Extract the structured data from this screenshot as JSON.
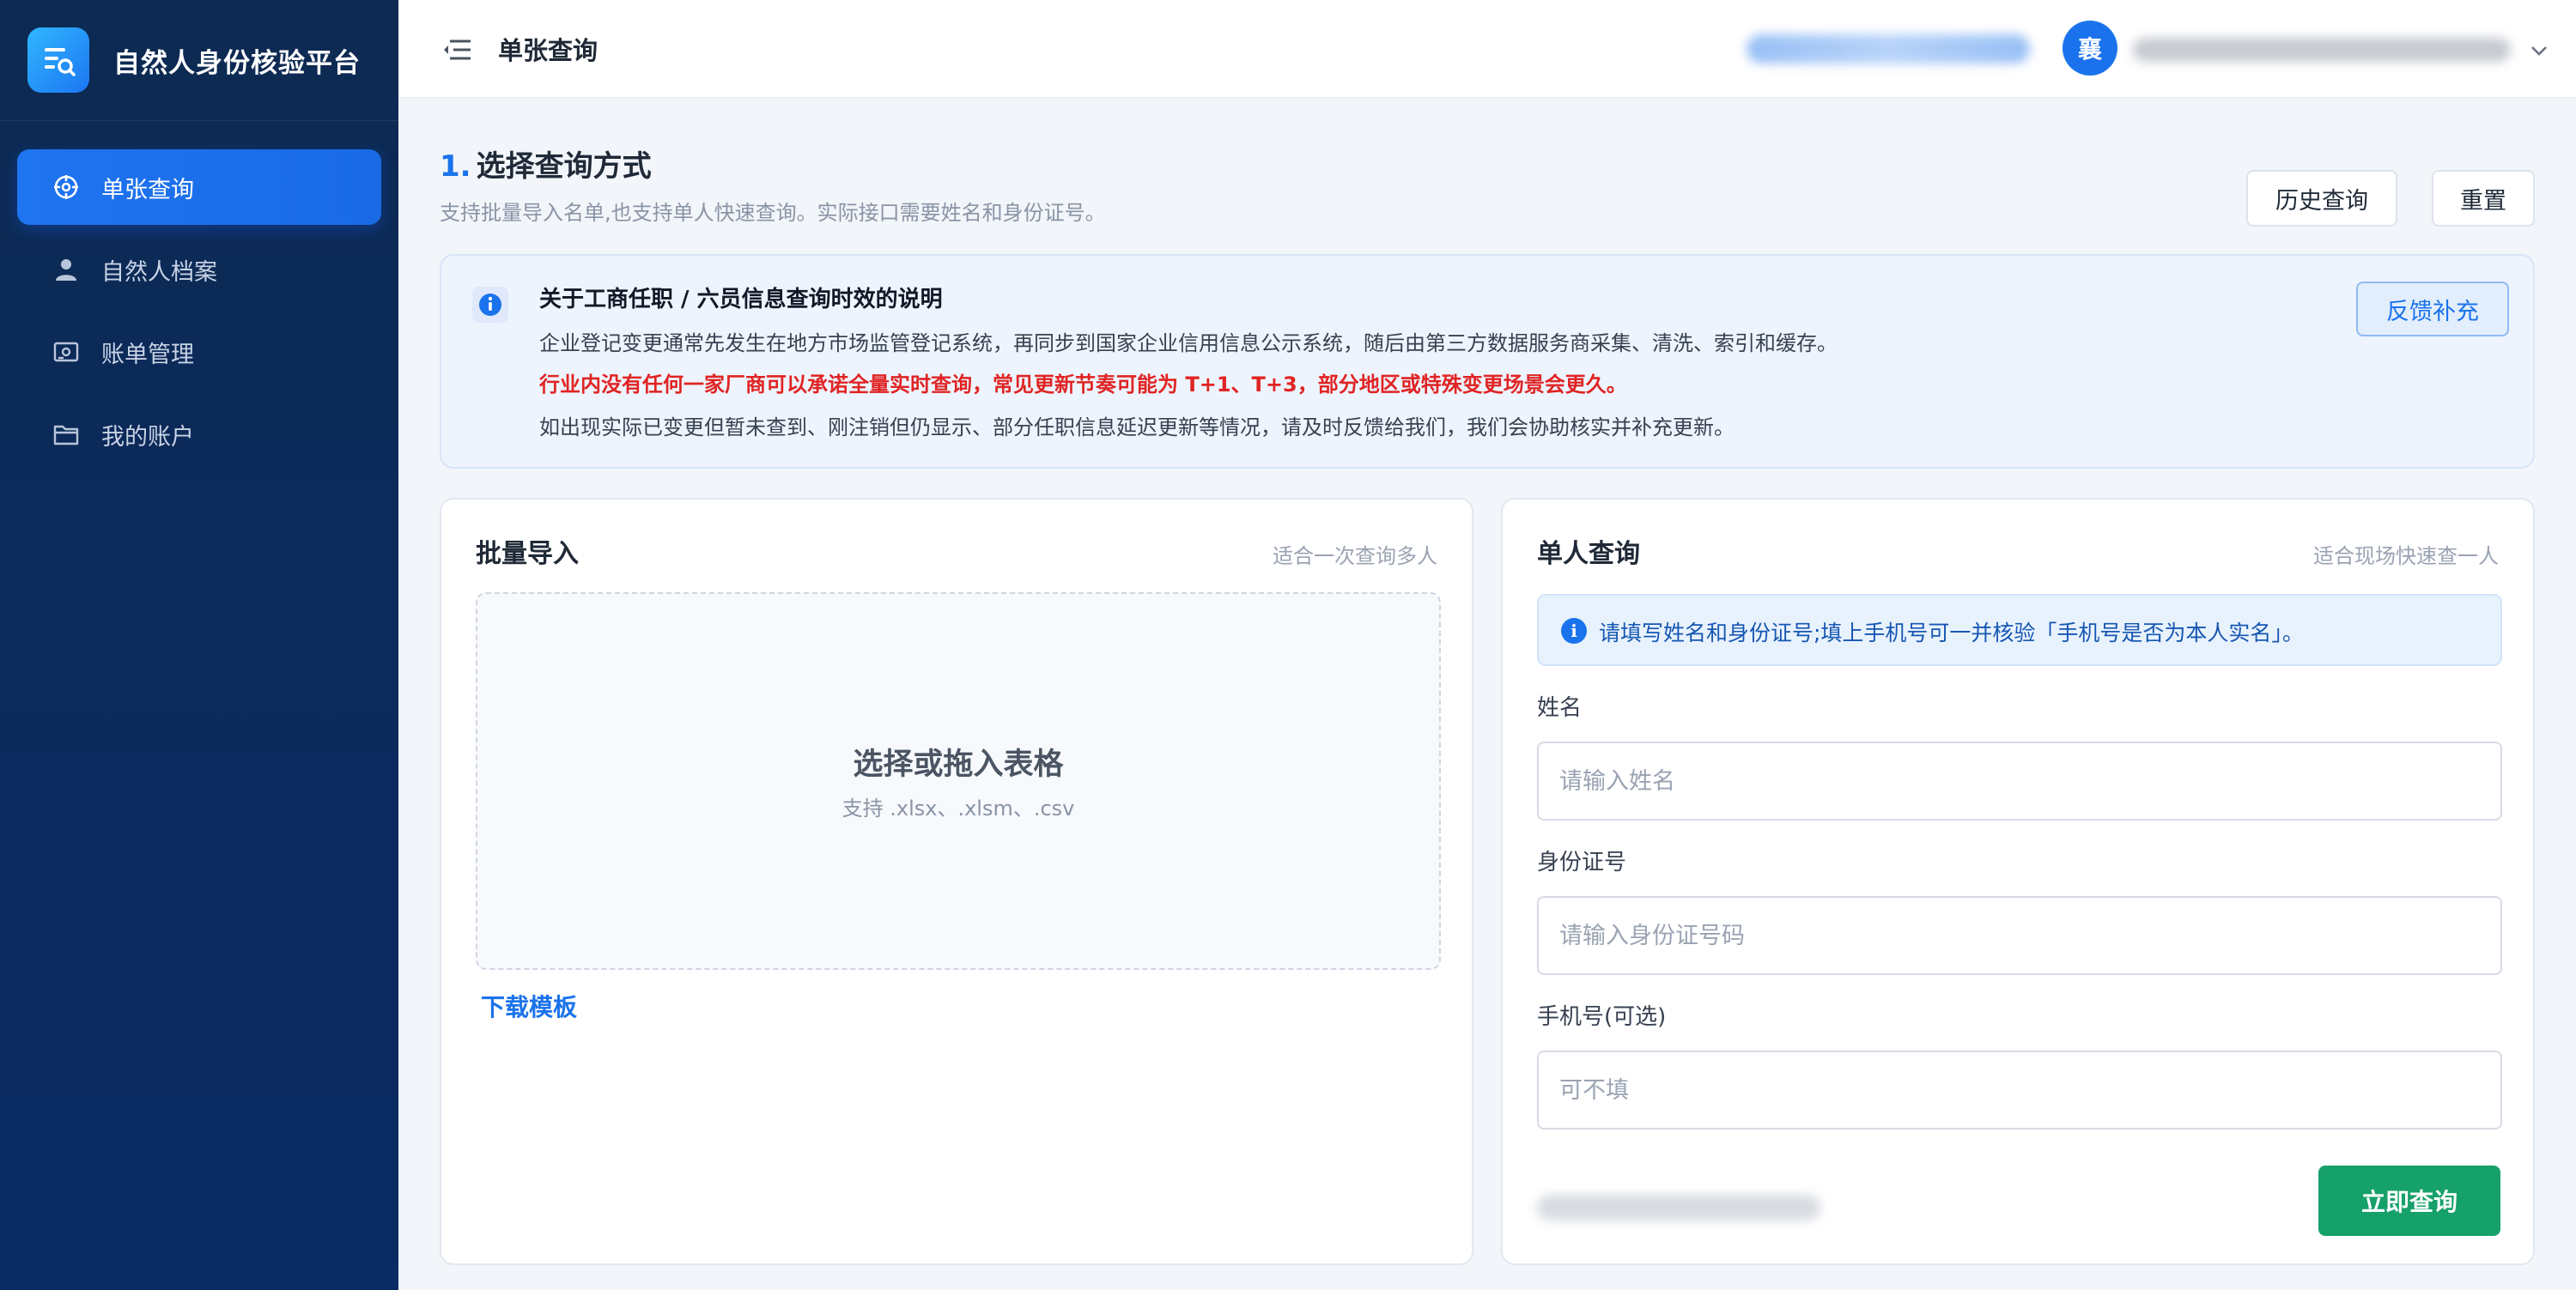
{
  "app": {
    "title": "自然人身份核验平台",
    "logo_icon": "search-document-icon"
  },
  "sidebar": {
    "items": [
      {
        "label": "单张查询",
        "icon": "target-icon",
        "active": true
      },
      {
        "label": "自然人档案",
        "icon": "user-icon",
        "active": false
      },
      {
        "label": "账单管理",
        "icon": "bill-icon",
        "active": false
      },
      {
        "label": "我的账户",
        "icon": "folder-icon",
        "active": false
      }
    ]
  },
  "header": {
    "title": "单张查询",
    "avatar_text": "襄"
  },
  "section": {
    "number": "1.",
    "title": "选择查询方式",
    "subtitle": "支持批量导入名单,也支持单人快速查询。实际接口需要姓名和身份证号。",
    "history_label": "历史查询",
    "reset_label": "重置"
  },
  "notice": {
    "title": "关于工商任职 / 六员信息查询时效的说明",
    "line1": "企业登记变更通常先发生在地方市场监管登记系统，再同步到国家企业信用信息公示系统，随后由第三方数据服务商采集、清洗、索引和缓存。",
    "line2": "行业内没有任何一家厂商可以承诺全量实时查询，常见更新节奏可能为 T+1、T+3，部分地区或特殊变更场景会更久。",
    "line3": "如出现实际已变更但暂未查到、刚注销但仍显示、部分任职信息延迟更新等情况，请及时反馈给我们，我们会协助核实并补充更新。",
    "feedback_label": "反馈补充"
  },
  "batch": {
    "title": "批量导入",
    "hint": "适合一次查询多人",
    "drop_title": "选择或拖入表格",
    "drop_sub": "支持 .xlsx、.xlsm、.csv",
    "template_link": "下载模板"
  },
  "single": {
    "title": "单人查询",
    "hint": "适合现场快速查一人",
    "tip": "请填写姓名和身份证号;填上手机号可一并核验「手机号是否为本人实名」。",
    "name_label": "姓名",
    "name_placeholder": "请输入姓名",
    "id_label": "身份证号",
    "id_placeholder": "请输入身份证号码",
    "phone_label": "手机号(可选)",
    "phone_placeholder": "可不填",
    "submit_label": "立即查询"
  },
  "colors": {
    "sidebar_bg": "#0d2a52",
    "accent": "#1a73ec",
    "warning_text": "#e02424",
    "submit": "#16a06a"
  }
}
